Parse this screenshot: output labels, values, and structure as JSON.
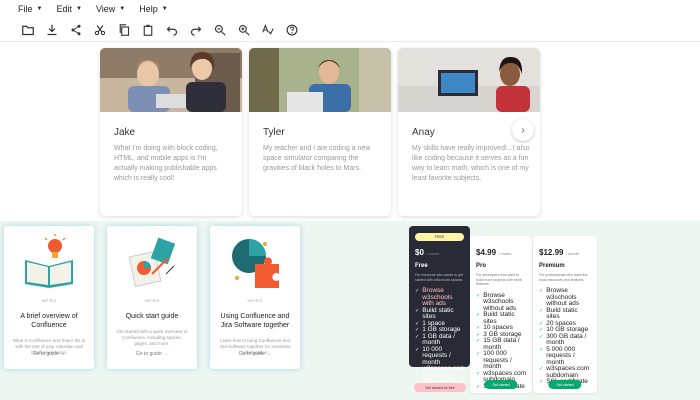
{
  "menu": [
    {
      "label": "File"
    },
    {
      "label": "Edit"
    },
    {
      "label": "View"
    },
    {
      "label": "Help"
    }
  ],
  "toolbar": [
    {
      "icon": "folder-icon"
    },
    {
      "icon": "download-icon"
    },
    {
      "icon": "share-icon"
    },
    {
      "icon": "cut-icon"
    },
    {
      "icon": "copy-icon"
    },
    {
      "icon": "paste-icon"
    },
    {
      "icon": "undo-icon"
    },
    {
      "icon": "redo-icon"
    },
    {
      "icon": "zoom-out-icon"
    },
    {
      "icon": "zoom-in-icon"
    },
    {
      "icon": "spellcheck-icon"
    },
    {
      "icon": "help-icon"
    }
  ],
  "testimonials": [
    {
      "name": "Jake",
      "quote": "What I'm doing with block coding, HTML, and mobile apps is I'm actually making publishable apps which is really cool!"
    },
    {
      "name": "Tyler",
      "quote": "My teacher and I are coding a new space simulator comparing the gravities of black holes to Mars."
    },
    {
      "name": "Anay",
      "quote": "My skills have really improved!...I also like coding because it serves as a fun way to learn math, which is one of my least favorite subjects."
    }
  ],
  "guides": [
    {
      "category": "INTRO",
      "title": "A brief overview of Confluence",
      "desc": "What is Confluence and how it fits in with the rest of your Atlassian and Confluence setup.",
      "link": "Go to guide →"
    },
    {
      "category": "INTRO",
      "title": "Quick start guide",
      "desc": "Get started with a quick overview of Confluence, including spaces, pages, and more.",
      "link": "Go to guide →"
    },
    {
      "category": "INTRO",
      "title": "Using Confluence and Jira Software together",
      "desc": "Learn how to bring Confluence and Jira Software together for seamless collaboration.",
      "link": "Go to guide →"
    }
  ],
  "pricing": [
    {
      "badge": "FREE",
      "price": "$0",
      "unit": "/ month",
      "plan": "Free",
      "desc": "For everyone who wants to get started with w3schools spaces.",
      "features": [
        "Browse w3schools with ads",
        "Build static sites",
        "1 space",
        "1 GB storage",
        "1 GB data / month",
        "10 000 requests / month",
        "w3spaces.com subdomain",
        "SSL certificate"
      ],
      "button": "Get started for free"
    },
    {
      "price": "$4.99",
      "unit": "/ month",
      "plan": "Pro",
      "desc": "For developers who want to build more projects with more features.",
      "features": [
        "Browse w3schools without ads",
        "Build static sites",
        "10 spaces",
        "3 GB storage",
        "15 GB data / month",
        "100 000 requests / month",
        "w3spaces.com subdomain",
        "SSL certificate"
      ],
      "button": "Get started"
    },
    {
      "price": "$12.99",
      "unit": "/ month",
      "plan": "Premium",
      "desc": "For professionals who want the most resources and features.",
      "features": [
        "Browse w3schools without ads",
        "Build static sites",
        "20 spaces",
        "10 GB storage",
        "300 GB data / month",
        "5 000 000 requests / month",
        "w3spaces.com subdomain",
        "SSL certificate"
      ],
      "button": "Get started"
    }
  ],
  "colors": {
    "accent": "#04aa6d",
    "dark": "#282a35",
    "badge": "#fff4a3",
    "pink": "#ffc0c7"
  }
}
